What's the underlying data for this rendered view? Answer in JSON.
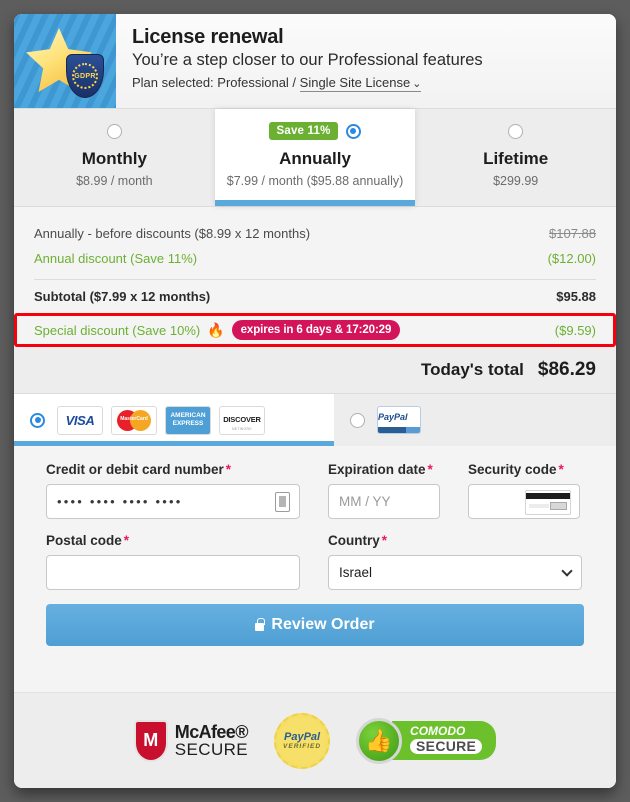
{
  "header": {
    "title": "License renewal",
    "subtitle": "You’re a step closer to our Professional features",
    "plan_prefix": "Plan selected: Professional / ",
    "plan_link": "Single Site License",
    "chevron": "⌄",
    "logo_badge": "GDPR"
  },
  "plans": [
    {
      "name": "Monthly",
      "price": "$8.99 / month",
      "badge": "",
      "selected": false
    },
    {
      "name": "Annually",
      "price": "$7.99 / month ($95.88 annually)",
      "badge": "Save 11%",
      "selected": true
    },
    {
      "name": "Lifetime",
      "price": "$299.99",
      "badge": "",
      "selected": false
    }
  ],
  "breakdown": {
    "rows": [
      {
        "label": "Annually - before discounts ($8.99 x 12 months)",
        "value": "$107.88",
        "style": "strike"
      },
      {
        "label": "Annual discount (Save 11%)",
        "value": "($12.00)",
        "style": "green"
      }
    ],
    "subtotal": {
      "label": "Subtotal ($7.99 x 12 months)",
      "value": "$95.88"
    },
    "special": {
      "label": "Special discount (Save 10%)",
      "flame": "🔥",
      "timer": "expires in 6 days & 17:20:29",
      "value": "($9.59)"
    },
    "total": {
      "label": "Today's total",
      "value": "$86.29"
    }
  },
  "payment": {
    "card_option": {
      "selected": true,
      "logos": [
        "VISA",
        "MasterCard",
        "AMERICAN EXPRESS",
        "DISCOVER"
      ]
    },
    "paypal_option": {
      "selected": false,
      "label": "PayPal"
    },
    "visa_text": "VISA",
    "mc_text": "MasterCard",
    "amex_line1": "AMERICAN",
    "amex_line2": "EXPRESS",
    "disc_line1": "DISCOVER",
    "disc_line2": "NETWORK",
    "pp_text": "PayPal"
  },
  "form": {
    "card_number": {
      "label": "Credit or debit card number",
      "required": "*",
      "value": "••••  ••••  ••••  ••••"
    },
    "expiration": {
      "label": "Expiration date",
      "required": "*",
      "placeholder": "MM / YY",
      "value": ""
    },
    "security_code": {
      "label": "Security code",
      "required": "*",
      "value": ""
    },
    "postal_code": {
      "label": "Postal code",
      "required": "*",
      "value": ""
    },
    "country": {
      "label": "Country",
      "required": "*",
      "value": "Israel"
    },
    "submit": "Review Order"
  },
  "footer": {
    "mcafee_line1": "McAfee®",
    "mcafee_line2": "SECURE",
    "mcafee_mark": "M",
    "paypal_line1": "PayPal",
    "paypal_line2": "VERIFIED",
    "comodo_line1": "COMODO",
    "comodo_line2": "SECURE",
    "comodo_icon": "👍"
  },
  "colors": {
    "accent_blue": "#5aa9dd",
    "green": "#6cb033",
    "alert_red": "#f5000f",
    "timer_pink": "#d4145a",
    "required_pink": "#e8175d"
  }
}
